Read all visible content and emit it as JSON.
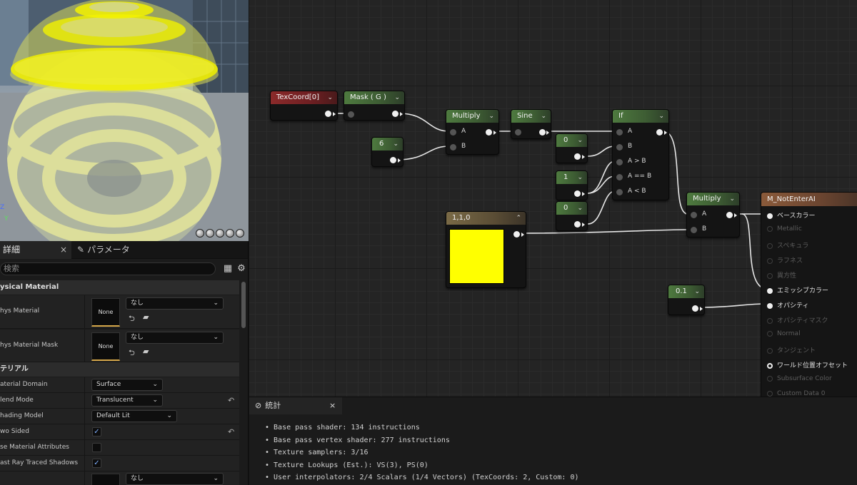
{
  "details_panel": {
    "tab_details": "詳細",
    "tab_parameters": "パラメータ",
    "tab_close": "×",
    "search_placeholder": "検索",
    "categories": {
      "physical_material": "ysical Material",
      "material": "テリアル"
    },
    "rows": {
      "phys_material": {
        "label": "hys Material",
        "thumb": "None",
        "value": "なし"
      },
      "phys_material_mask": {
        "label": "hys Material Mask",
        "thumb": "None",
        "value": "なし"
      },
      "material_domain": {
        "label": "aterial Domain",
        "value": "Surface"
      },
      "blend_mode": {
        "label": "lend Mode",
        "value": "Translucent"
      },
      "shading_model": {
        "label": "hading Model",
        "value": "Default Lit"
      },
      "two_sided": {
        "label": "wo Sided",
        "checked": true
      },
      "use_material_attributes": {
        "label": "se Material Attributes",
        "checked": false
      },
      "cast_ray_traced_shadows": {
        "label": "ast Ray Traced Shadows",
        "checked": true
      },
      "last_row": {
        "value": "なし"
      }
    }
  },
  "viewport": {
    "axis_z": "Z",
    "axis_y": "Y"
  },
  "graph": {
    "nodes": {
      "texcoord": {
        "title": "TexCoord[0]"
      },
      "mask": {
        "title": "Mask ( G )"
      },
      "const6": {
        "title": "6"
      },
      "multiply1": {
        "title": "Multiply",
        "pins": [
          "A",
          "B"
        ]
      },
      "sine": {
        "title": "Sine"
      },
      "const0a": {
        "title": "0"
      },
      "const1": {
        "title": "1"
      },
      "const0b": {
        "title": "0"
      },
      "if": {
        "title": "If",
        "pins": [
          "A",
          "B",
          "A > B",
          "A == B",
          "A < B"
        ]
      },
      "color": {
        "title": "1,1,0",
        "swatch": "#ffff00"
      },
      "multiply2": {
        "title": "Multiply",
        "pins": [
          "A",
          "B"
        ]
      },
      "const01": {
        "title": "0.1"
      }
    },
    "output_node": {
      "title": "M_NotEnterAI",
      "pins": [
        {
          "label": "ベースカラー",
          "active": true
        },
        {
          "label": "Metallic",
          "active": false
        },
        {
          "label": "スペキュラ",
          "active": false
        },
        {
          "label": "ラフネス",
          "active": false
        },
        {
          "label": "異方性",
          "active": false
        },
        {
          "label": "エミッシブカラー",
          "active": true
        },
        {
          "label": "オパシティ",
          "active": true
        },
        {
          "label": "オパシティマスク",
          "active": false
        },
        {
          "label": "Normal",
          "active": false
        },
        {
          "label": "タンジェント",
          "active": false
        },
        {
          "label": "ワールド位置オフセット",
          "active": true
        },
        {
          "label": "Subsurface Color",
          "active": false
        },
        {
          "label": "Custom Data 0",
          "active": false
        }
      ]
    }
  },
  "stats_panel": {
    "tab_label": "統計",
    "tab_close": "×",
    "lines": [
      "Base pass shader: 134 instructions",
      "Base pass vertex shader: 277 instructions",
      "Texture samplers: 3/16",
      "Texture Lookups (Est.): VS(3), PS(0)",
      "User interpolators: 2/4 Scalars (1/4 Vectors) (TexCoords: 2, Custom: 0)"
    ]
  },
  "colors": {
    "accent_yellow": "#ffff00",
    "node_green": "#4e7a3f",
    "node_red": "#8b2a2a",
    "background": "#242424"
  }
}
